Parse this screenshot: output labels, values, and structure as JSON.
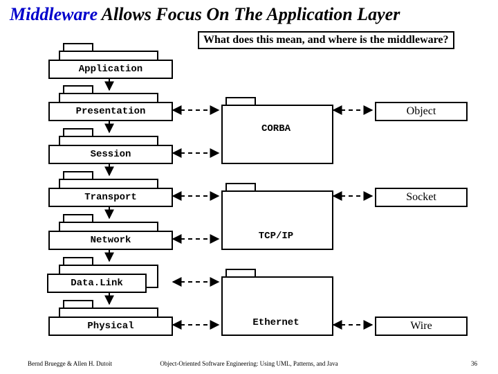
{
  "title": {
    "highlight": "Middleware",
    "rest": " Allows  Focus On The Application Layer"
  },
  "question": "What does this mean, and where is the middleware?",
  "osi": {
    "application": "Application",
    "presentation": "Presentation",
    "session": "Session",
    "transport": "Transport",
    "network": "Network",
    "datalink": "Data.Link",
    "physical": "Physical"
  },
  "mid": {
    "corba": "CORBA",
    "tcpip": "TCP/IP",
    "ethernet": "Ethernet"
  },
  "right": {
    "object": "Object",
    "socket": "Socket",
    "wire": "Wire"
  },
  "footer": {
    "left": "Bernd Bruegge & Allen H. Dutoit",
    "center": "Object-Oriented Software Engineering: Using UML, Patterns, and Java",
    "page": "36"
  }
}
